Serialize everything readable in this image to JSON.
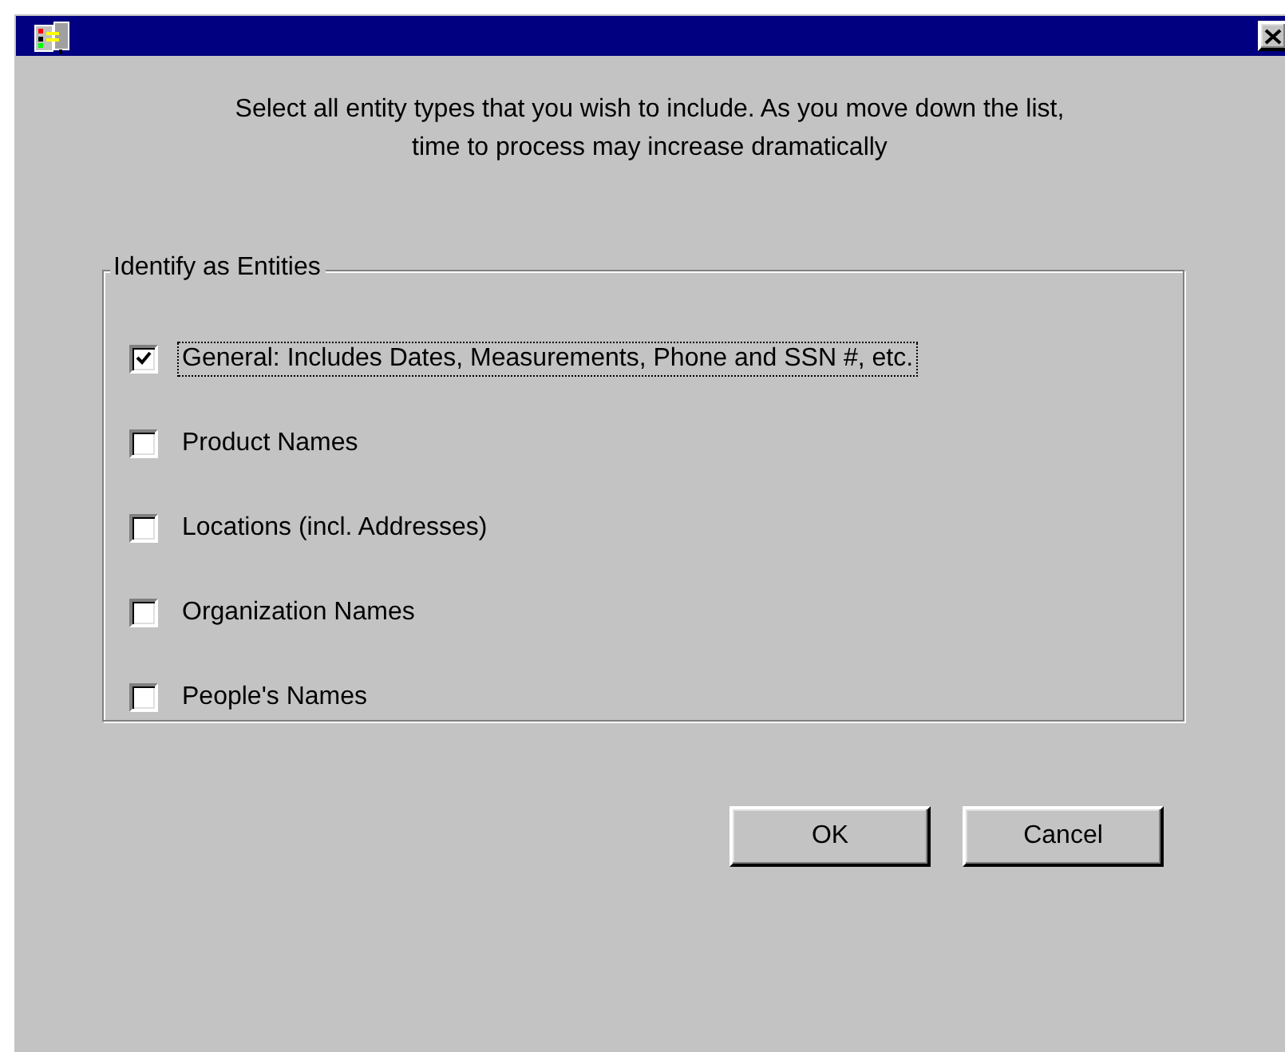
{
  "instructions": "Select all entity types that you wish to include. As you move down the list, time to process may increase dramatically",
  "group": {
    "label": "Identify as Entities",
    "items": [
      {
        "label": "General: Includes Dates, Measurements, Phone and SSN #, etc.",
        "checked": true,
        "focused": true
      },
      {
        "label": "Product Names",
        "checked": false,
        "focused": false
      },
      {
        "label": "Locations (incl. Addresses)",
        "checked": false,
        "focused": false
      },
      {
        "label": "Organization Names",
        "checked": false,
        "focused": false
      },
      {
        "label": "People's Names",
        "checked": false,
        "focused": false
      }
    ]
  },
  "buttons": [
    "OK",
    "Cancel"
  ]
}
